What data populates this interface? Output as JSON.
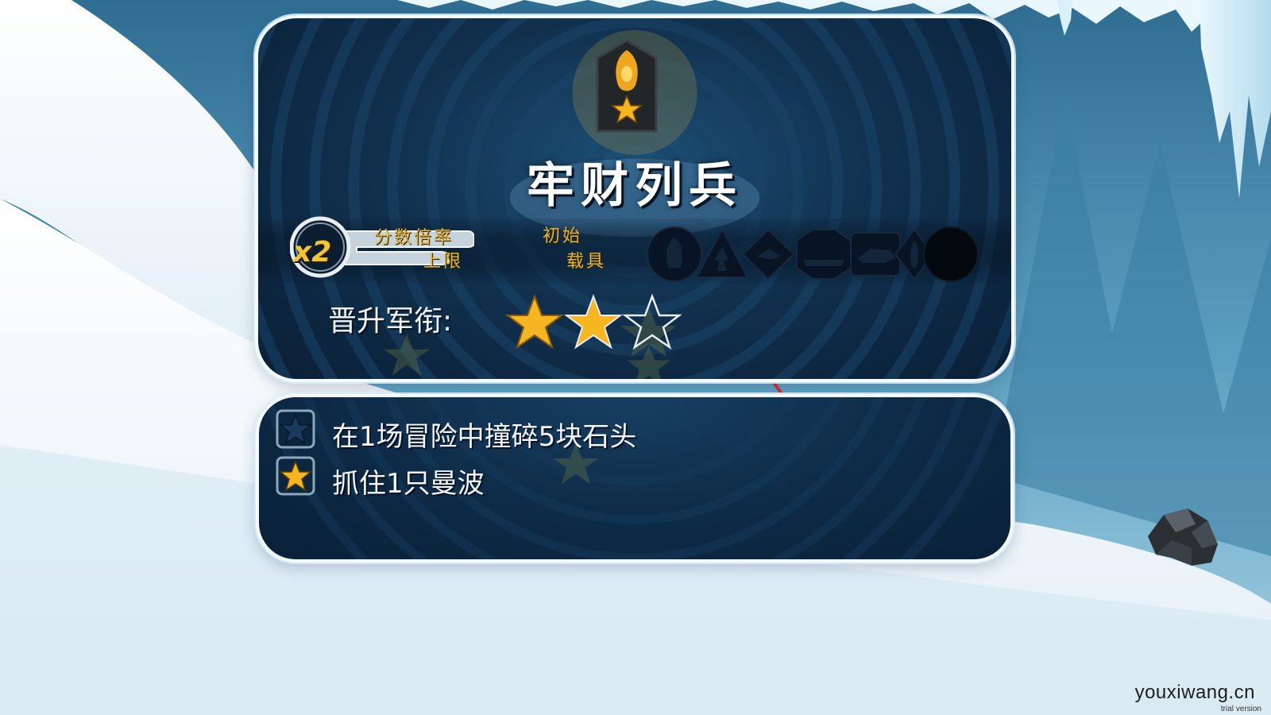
{
  "rank_card": {
    "title": "牢财列兵",
    "multiplier_value": "x2",
    "multiplier_label_line1": "分数倍率",
    "multiplier_label_line2": "上限",
    "vehicle_label_line1": "初始",
    "vehicle_label_line2": "载具",
    "vehicle_icons": [
      "penguin-icon",
      "runner-icon",
      "bird-icon",
      "sled-icon",
      "wolf-icon",
      "penguin-suit-icon",
      "locked-slot-icon"
    ],
    "promotion_label": "晋升军衔:",
    "promotion_stars_total": 3,
    "promotion_stars_earned": 2
  },
  "missions": [
    {
      "text": "在1场冒险中撞碎5块石头",
      "completed": false
    },
    {
      "text": "抓住1只曼波",
      "completed": true
    }
  ],
  "watermark": "youxiwang.cn",
  "watermark_small": "trial version",
  "colors": {
    "panel_dark": "#0d2a46",
    "accent_gold": "#f5b621",
    "annotation_red": "#e02530",
    "snow": "#f4f9fc",
    "ice_blue": "#8cc3dc"
  }
}
